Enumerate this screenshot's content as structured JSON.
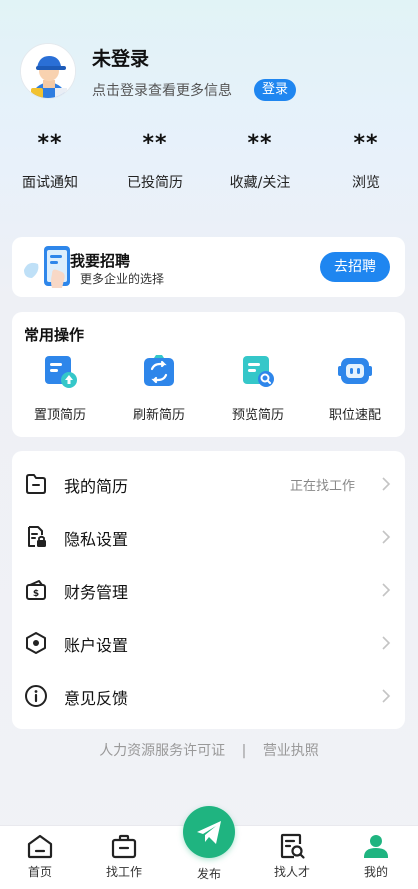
{
  "profile": {
    "name": "未登录",
    "hint": "点击登录查看更多信息",
    "login_label": "登录"
  },
  "stats": [
    {
      "value": "**",
      "label": "面试通知"
    },
    {
      "value": "**",
      "label": "已投简历"
    },
    {
      "value": "**",
      "label": "收藏/关注"
    },
    {
      "value": "**",
      "label": "浏览"
    }
  ],
  "recruit": {
    "title": "我要招聘",
    "subtitle": "更多企业的选择",
    "button": "去招聘"
  },
  "quick_actions": {
    "title": "常用操作",
    "items": [
      {
        "label": "置顶简历",
        "icon": "pin-resume-icon"
      },
      {
        "label": "刷新简历",
        "icon": "refresh-resume-icon"
      },
      {
        "label": "预览简历",
        "icon": "preview-resume-icon"
      },
      {
        "label": "职位速配",
        "icon": "job-match-robot-icon"
      }
    ]
  },
  "menu": [
    {
      "label": "我的简历",
      "extra": "正在找工作",
      "icon": "folder-icon"
    },
    {
      "label": "隐私设置",
      "extra": "",
      "icon": "privacy-lock-icon"
    },
    {
      "label": "财务管理",
      "extra": "",
      "icon": "wallet-icon"
    },
    {
      "label": "账户设置",
      "extra": "",
      "icon": "settings-hexagon-icon"
    },
    {
      "label": "意见反馈",
      "extra": "",
      "icon": "info-icon"
    }
  ],
  "footer": {
    "license": "人力资源服务许可证",
    "separator": "|",
    "business": "营业执照"
  },
  "nav": [
    {
      "label": "首页",
      "icon": "home-icon"
    },
    {
      "label": "找工作",
      "icon": "briefcase-icon"
    },
    {
      "label": "发布",
      "icon": "send-icon"
    },
    {
      "label": "找人才",
      "icon": "find-talent-icon"
    },
    {
      "label": "我的",
      "icon": "profile-icon"
    }
  ],
  "colors": {
    "accent_blue": "#1f86f0",
    "publish_green": "#1fb480",
    "active_green": "#1fb480"
  }
}
